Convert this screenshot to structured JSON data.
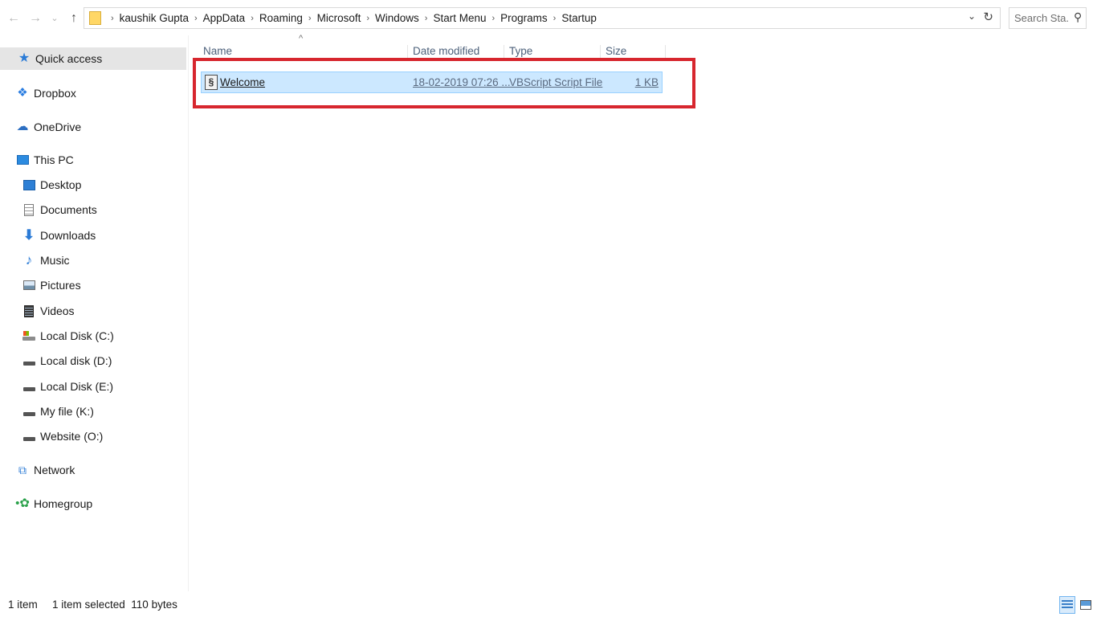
{
  "toolbar": {
    "back_glyph": "←",
    "forward_glyph": "→",
    "recent_glyph": "⌄",
    "up_glyph": "↑"
  },
  "address": {
    "crumbs": [
      "kaushik Gupta",
      "AppData",
      "Roaming",
      "Microsoft",
      "Windows",
      "Start Menu",
      "Programs",
      "Startup"
    ],
    "separator": "›",
    "dropdown_glyph": "⌄",
    "refresh_glyph": "↻"
  },
  "search": {
    "placeholder": "Search Sta...",
    "icon_glyph": "⚲"
  },
  "nav": {
    "quick_access": "Quick access",
    "dropbox": "Dropbox",
    "onedrive": "OneDrive",
    "this_pc": "This PC",
    "desktop": "Desktop",
    "documents": "Documents",
    "downloads": "Downloads",
    "music": "Music",
    "pictures": "Pictures",
    "videos": "Videos",
    "local_disk_c": "Local Disk (C:)",
    "local_disk_d": "Local disk (D:)",
    "local_disk_e": "Local Disk (E:)",
    "my_file_k": "My file (K:)",
    "website_o": "Website (O:)",
    "network": "Network",
    "homegroup": "Homegroup",
    "icons": {
      "star": "★",
      "dropbox": "❖",
      "cloud": "☁",
      "down": "⬇",
      "music": "♪",
      "network": "⧉",
      "home": "•✿"
    }
  },
  "columns": {
    "name": "Name",
    "date_modified": "Date modified",
    "type": "Type",
    "size": "Size",
    "sort_glyph": "^"
  },
  "files": [
    {
      "name": "Welcome",
      "date_modified": "18-02-2019 07:26 ...",
      "type": "VBScript Script File",
      "size": "1 KB",
      "icon_glyph": "§",
      "selected": true
    }
  ],
  "status": {
    "item_count": "1 item",
    "selection": "1 item selected  110 bytes"
  },
  "colors": {
    "selection_fill": "#cce8ff",
    "selection_border": "#99d1ff",
    "annotation_red": "#d7262e",
    "nav_selected": "#e5e5e5"
  }
}
